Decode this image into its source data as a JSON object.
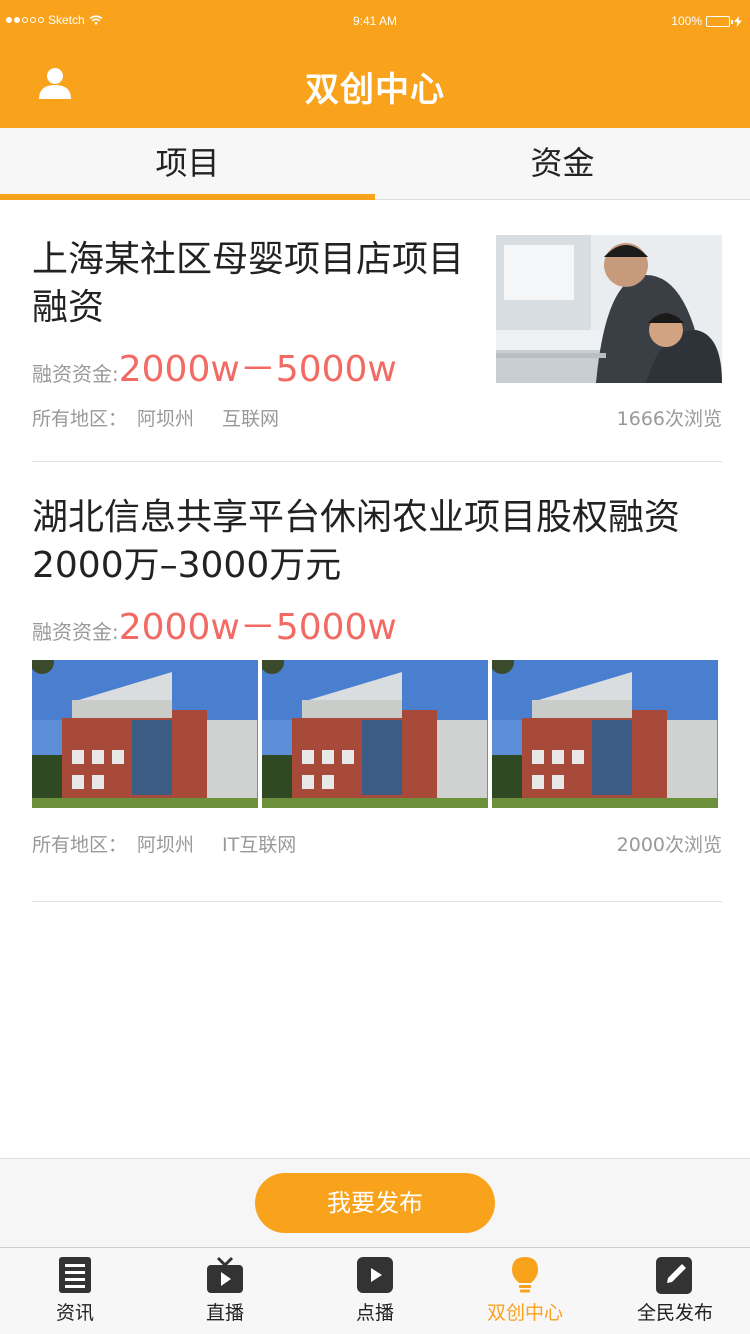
{
  "status_bar": {
    "carrier": "Sketch",
    "time": "9:41 AM",
    "battery": "100%"
  },
  "header": {
    "title": "双创中心"
  },
  "tabs": [
    {
      "label": "项目",
      "active": true
    },
    {
      "label": "资金",
      "active": false
    }
  ],
  "feed": [
    {
      "title": "上海某社区母婴项目店项目融资",
      "fund_label": "融资资金:",
      "fund_value": "2000w－5000w",
      "region_label": "所有地区：",
      "region": "阿坝州",
      "category": "互联网",
      "views": "1666次浏览"
    },
    {
      "title": "湖北信息共享平台休闲农业项目股权融资2000万–3000万元",
      "fund_label": "融资资金:",
      "fund_value": "2000w－5000w",
      "region_label": "所有地区：",
      "region": "阿坝州",
      "category": "IT互联网",
      "views": "2000次浏览"
    }
  ],
  "publish_button": "我要发布",
  "tabbar": [
    {
      "label": "资讯",
      "icon": "news-icon",
      "active": false
    },
    {
      "label": "直播",
      "icon": "live-tv-icon",
      "active": false
    },
    {
      "label": "点播",
      "icon": "play-icon",
      "active": false
    },
    {
      "label": "双创中心",
      "icon": "lightbulb-icon",
      "active": true
    },
    {
      "label": "全民发布",
      "icon": "edit-icon",
      "active": false
    }
  ],
  "colors": {
    "accent": "#f9a21c",
    "price": "#f26a63",
    "muted": "#999999"
  }
}
